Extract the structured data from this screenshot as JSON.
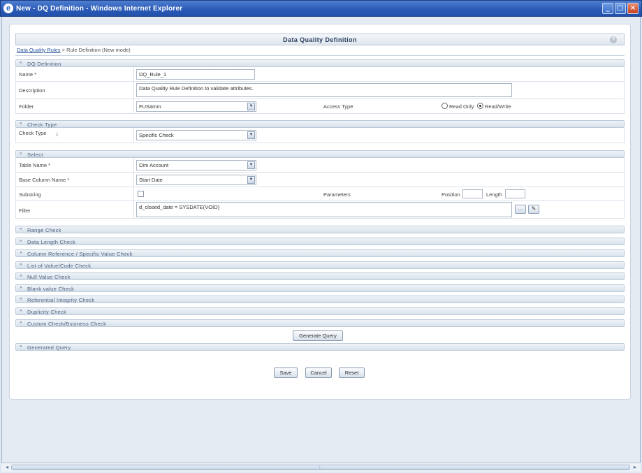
{
  "window": {
    "title": "New - DQ Definition - Windows Internet Explorer",
    "icon": "internet-explorer-icon"
  },
  "header": {
    "title": "Data Quality Definition",
    "help": "?"
  },
  "breadcrumb": {
    "root": "Data Quality Rules",
    "separator": " > ",
    "current": "Rule Definition (New mode)"
  },
  "sections": {
    "dq_definition": "DQ Definition",
    "check_type": "Check Type",
    "select": "Select",
    "collapsed": [
      "Range Check",
      "Data Length Check",
      "Column Reference / Specific Value Check",
      "List of Value/Code Check",
      "Null Value Check",
      "Blank value Check",
      "Referential Integrity Check",
      "Duplicity Check",
      "Custom Check/Business Check"
    ],
    "generated_query": "Generated Query"
  },
  "toggles": {
    "expanded": "«",
    "collapsed": "»"
  },
  "dq_definition": {
    "name_label": "Name *",
    "name_value": "DQ_Rule_1",
    "description_label": "Description",
    "description_value": "Data Quality Rule Definition to validate attributes.",
    "folder_label": "Folder",
    "folder_value": "FUSamm",
    "access_type_label": "Access Type",
    "read_only_label": "Read Only",
    "read_write_label": "Read/Write",
    "access_selected": "Read/Write"
  },
  "check_type": {
    "label": "Check Type",
    "info": "i",
    "value": "Specific Check"
  },
  "select": {
    "table_label": "Table Name *",
    "table_value": "Dim Account",
    "column_label": "Base Column Name *",
    "column_value": "Start Date",
    "substring_label": "Substring",
    "parameters_label": "Parameters",
    "position_label": "Position",
    "length_label": "Length",
    "filter_label": "Filter",
    "filter_value": "d_closed_date = SYSDATE(VOID)",
    "ellipsis": "..."
  },
  "buttons": {
    "generate_query": "Generate Query",
    "save": "Save",
    "cancel": "Cancel",
    "reset": "Reset"
  },
  "colors": {
    "titlebar": "#2b5bb8",
    "section_text": "#4e6280",
    "link": "#2b57a1"
  }
}
